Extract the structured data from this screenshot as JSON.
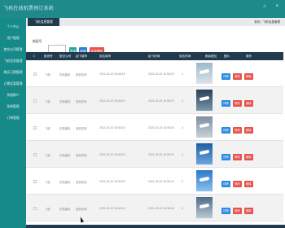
{
  "app": {
    "title": "飞机在线机票预订系统"
  },
  "top_icons": [
    "home-icon",
    "close-icon"
  ],
  "sidebar": {
    "items": [
      {
        "label": "个人中心"
      },
      {
        "label": "用户管理"
      },
      {
        "label": "航空公司管理"
      },
      {
        "label": "飞机信息管理"
      },
      {
        "label": "购买订票管理"
      },
      {
        "label": "订票优惠管理"
      },
      {
        "label": "系统简介"
      },
      {
        "label": "系统管理"
      },
      {
        "label": "订单管理"
      }
    ]
  },
  "tab": {
    "active": "飞机信息管理"
  },
  "breadcrumb": "首页 / 飞机信息管理",
  "search": {
    "label": "航班号",
    "placeholder": ""
  },
  "buttons": {
    "search": "查询",
    "add": "新增",
    "delete": "批量删除"
  },
  "table": {
    "headers": [
      "航班号",
      "航空公司",
      "起飞城市",
      "到达城市",
      "起飞时间",
      "到达时间",
      "剩余座位",
      "图片",
      "操作"
    ],
    "rows": [
      {
        "no": "飞机",
        "airline": "东航客机",
        "from": "西安机场",
        "depart": "2021-03-22 16:58:15",
        "arrive": "2021-03-22 16:58:15",
        "seats": "1"
      },
      {
        "no": "飞机",
        "airline": "东航客机",
        "from": "西安机场",
        "depart": "2021-03-22 16:58:15",
        "arrive": "2021-03-22 16:58:15",
        "seats": "2"
      },
      {
        "no": "飞机",
        "airline": "东航客机",
        "from": "西安机场",
        "depart": "2021-03-22 16:58:15",
        "arrive": "2021-03-22 16:58:15",
        "seats": "3"
      },
      {
        "no": "飞机",
        "airline": "东航客机",
        "from": "西安机场",
        "depart": "2021-03-22 16:58:15",
        "arrive": "2021-03-22 16:58:15",
        "seats": "4"
      },
      {
        "no": "飞机",
        "airline": "东航客机",
        "from": "西安机场",
        "depart": "2021-03-22 16:58:15",
        "arrive": "2021-03-22 16:58:15",
        "seats": "5"
      },
      {
        "no": "飞机",
        "airline": "东航客机",
        "from": "西安机场",
        "depart": "2021-03-22 16:58:15",
        "arrive": "2021-03-22 16:58:15",
        "seats": "6"
      }
    ],
    "actions": {
      "view": "详情",
      "edit": "修改",
      "delete": "删除"
    }
  },
  "colors": {
    "topbar": "#1f8a8a",
    "sidebar": "#168a88",
    "table_header": "#213a4d",
    "search_btn": "#26a69a",
    "add_btn": "#2b7fd6",
    "delete_btn": "#e5534b"
  }
}
